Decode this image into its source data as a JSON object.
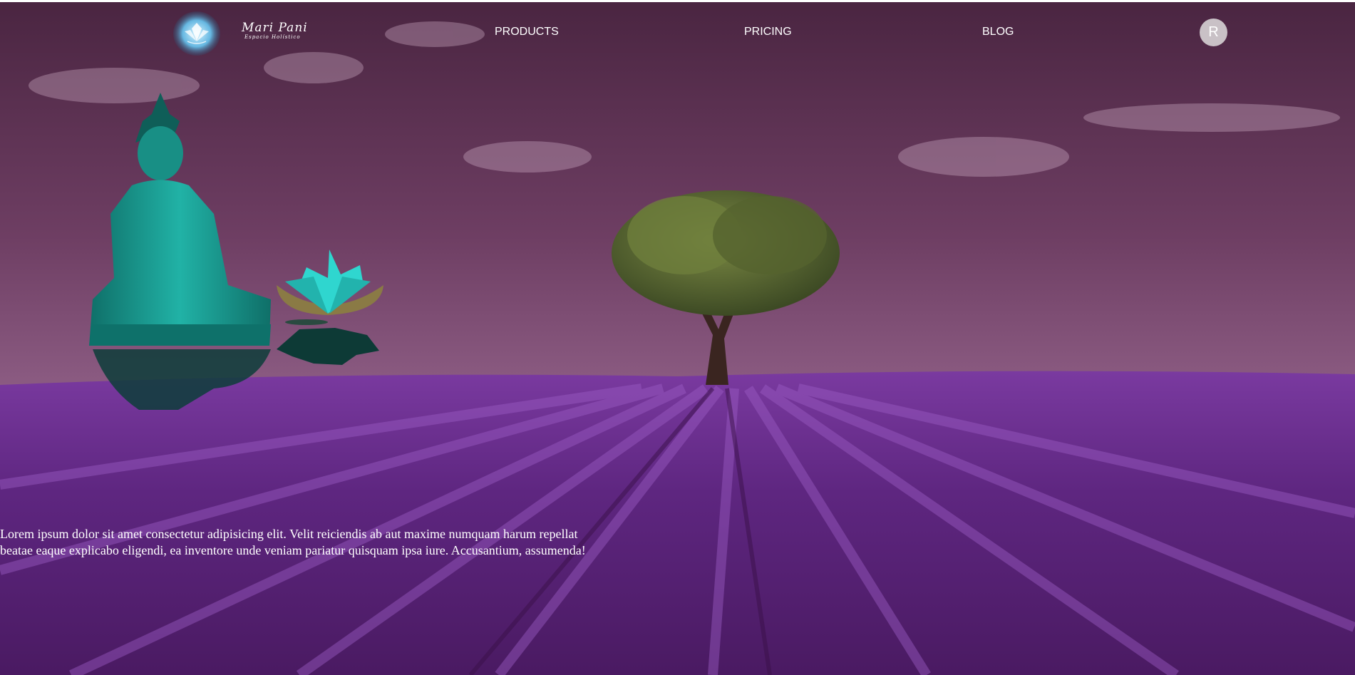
{
  "brand": {
    "name": "Mari Pani",
    "tagline": "Espacio Holístico",
    "logo_icon": "lotus-icon"
  },
  "nav": {
    "items": [
      {
        "label": "PRODUCTS"
      },
      {
        "label": "PRICING"
      },
      {
        "label": "BLOG"
      }
    ]
  },
  "user": {
    "avatar_initial": "R"
  },
  "hero": {
    "text": "Lorem ipsum dolor sit amet consectetur adipisicing elit. Velit reiciendis ab aut maxime numquam harum repellat beatae eaque explicabo eligendi, ea inventore unde veniam pariatur quisquam ipsa iure. Accusantium, assumenda!",
    "background_icons": [
      "buddha-statue-icon",
      "lotus-flower-icon",
      "tree-icon",
      "lavender-field-icon"
    ]
  },
  "colors": {
    "sky_top": "#4a2541",
    "sky_bottom": "#b07ea8",
    "lavender": "#6b2c8a",
    "statue": "#1a9a8e",
    "lotus": "#2fd6cf",
    "tree": "#5b6b32",
    "avatar_bg": "#c9c1c6"
  }
}
